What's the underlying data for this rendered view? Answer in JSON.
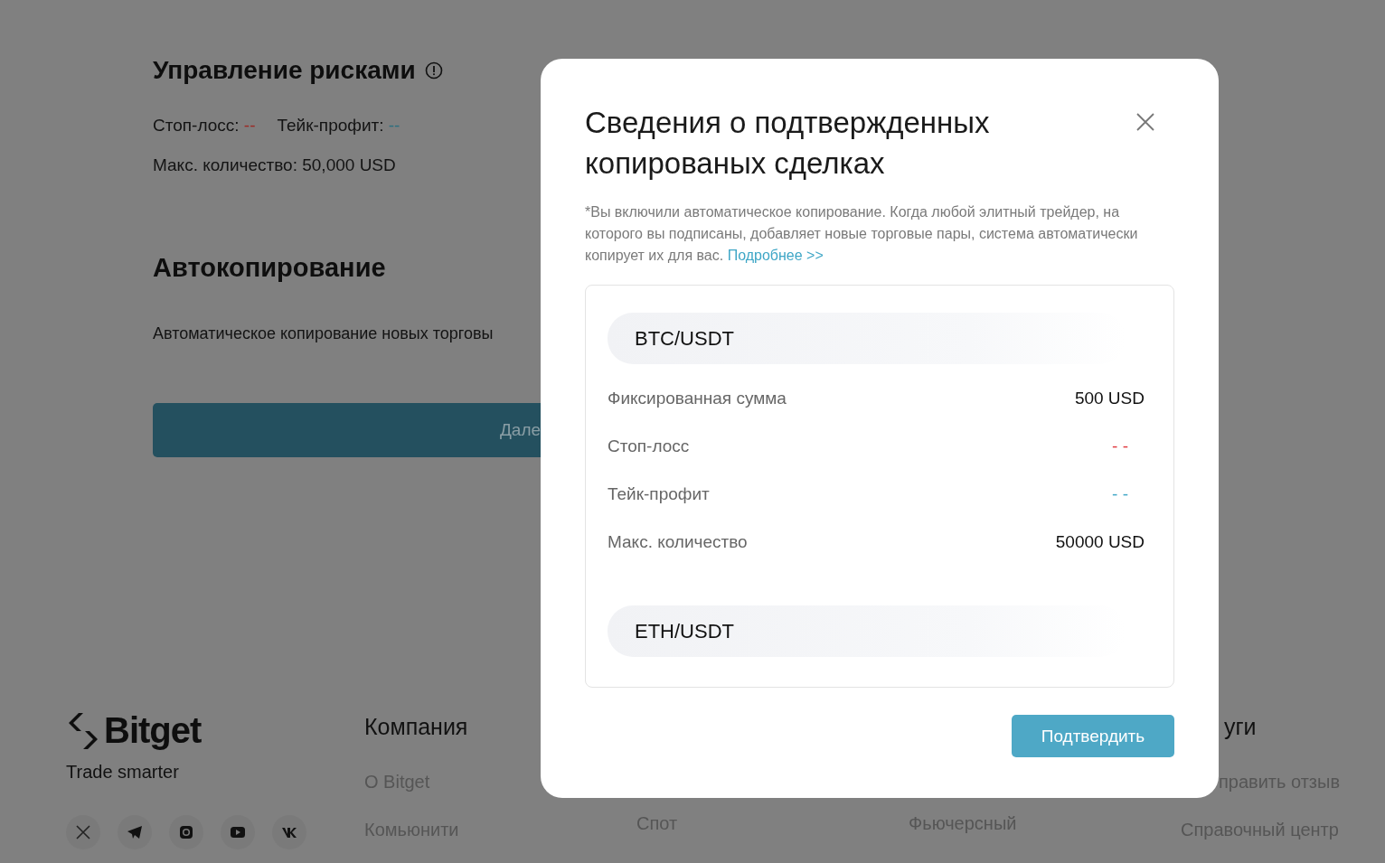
{
  "risk": {
    "title": "Управление рисками",
    "stop_loss_label": "Стоп-лосс:",
    "stop_loss_value": "--",
    "take_profit_label": "Тейк-профит:",
    "take_profit_value": "--",
    "max_amount": "Макс. количество: 50,000 USD"
  },
  "autocopy": {
    "title": "Автокопирование",
    "description": "Автоматическое копирование новых торговы",
    "button": "Дале"
  },
  "footer": {
    "brand": "Bitget",
    "tagline": "Trade smarter",
    "socials": [
      {
        "kind": "x"
      },
      {
        "kind": "telegram"
      },
      {
        "kind": "instagram"
      },
      {
        "kind": "youtube"
      },
      {
        "kind": "vk"
      }
    ],
    "columns": [
      {
        "heading": "Компания",
        "links": [
          "О Bitget",
          "Комьюнити"
        ]
      },
      {
        "links": [
          "Спот"
        ]
      },
      {
        "links": [
          "Фьючерсный"
        ]
      },
      {
        "heading": "уги",
        "links": [
          "править отзыв",
          "Справочный центр"
        ]
      }
    ]
  },
  "modal": {
    "title": "Сведения о подтвержденных копированых сделках",
    "note": "*Вы включили автоматическое копирование. Когда любой элитный трейдер, на которого вы подписаны, добавляет новые торговые пары, система автоматически копирует их для вас.",
    "link": "Подробнее >>",
    "pairs": [
      {
        "symbol": "BTC/USDT",
        "rows": [
          {
            "kind": "value",
            "label": "Фиксированная сумма",
            "value": "500 USD"
          },
          {
            "kind": "loss",
            "label": "Стоп-лосс",
            "value": "- -"
          },
          {
            "kind": "profit",
            "label": "Тейк-профит",
            "value": "- -"
          },
          {
            "kind": "value",
            "label": "Макс. количество",
            "value": "50000 USD"
          }
        ]
      },
      {
        "symbol": "ETH/USDT"
      }
    ],
    "confirm": "Подтвердить"
  }
}
